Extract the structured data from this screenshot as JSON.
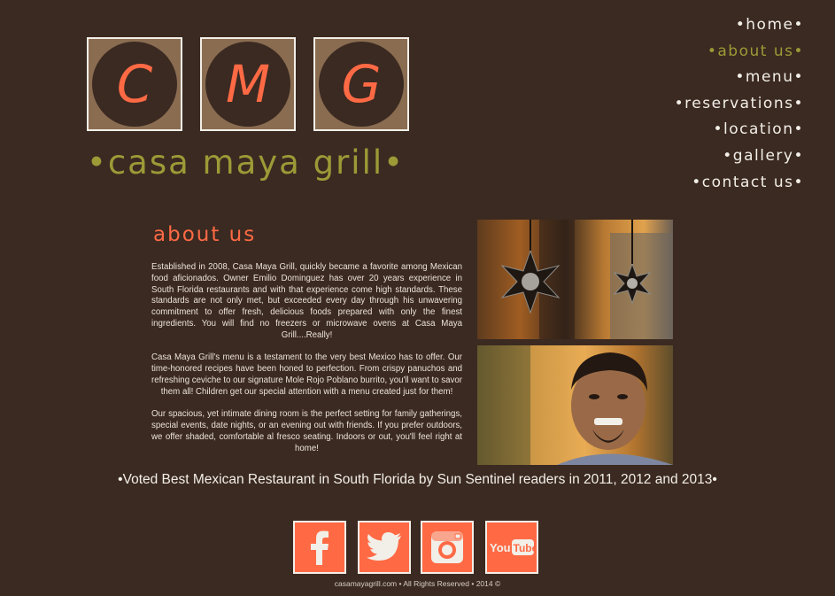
{
  "logo": {
    "letters": [
      "C",
      "M",
      "G"
    ],
    "tagline": "•casa maya grill•"
  },
  "nav": {
    "items": [
      {
        "label": "•home•"
      },
      {
        "label": "•about us•"
      },
      {
        "label": "•menu•"
      },
      {
        "label": "•reservations•"
      },
      {
        "label": "•location•"
      },
      {
        "label": "•gallery•"
      },
      {
        "label": "•contact us•"
      }
    ],
    "active": "•about us•"
  },
  "about": {
    "title": "about us",
    "paragraphs": [
      "Established in 2008, Casa Maya Grill, quickly became a favorite among Mexican food aficionados. Owner Emilio Dominguez has over 20 years experience in South Florida restaurants and with that experience come high standards. These standards are not only met, but exceeded every day through his unwavering commitment to offer fresh, delicious foods prepared with only the finest ingredients. You will find no freezers or microwave ovens at Casa Maya Grill....Really!",
      "Casa Maya Grill's menu is a testament to the very best Mexico has to offer. Our time-honored recipes have been honed to perfection. From crispy panuchos and refreshing ceviche to our signature Mole Rojo Poblano burrito, you'll want to savor them all! Children get our special attention with a menu created just for them!",
      "Our spacious, yet intimate dining room is the perfect setting for family gatherings, special events, date nights, or an evening out with friends. If you prefer outdoors, we offer shaded, comfortable al fresco seating. Indoors or out, you'll feel right at home!"
    ]
  },
  "award": "•Voted Best Mexican Restaurant in South Florida by Sun Sentinel readers in 2011, 2012 and 2013•",
  "social": [
    {
      "icon": "facebook-icon"
    },
    {
      "icon": "twitter-icon"
    },
    {
      "icon": "instagram-icon"
    },
    {
      "icon": "youtube-icon",
      "label": "YouTube"
    }
  ],
  "footer": "casamayagrill.com • All Rights Reserved • 2014 ©",
  "colors": {
    "background": "#3b2a21",
    "accent_orange": "#ff6a45",
    "accent_olive": "#9c9a37",
    "tile_brown": "#8a6c51"
  }
}
